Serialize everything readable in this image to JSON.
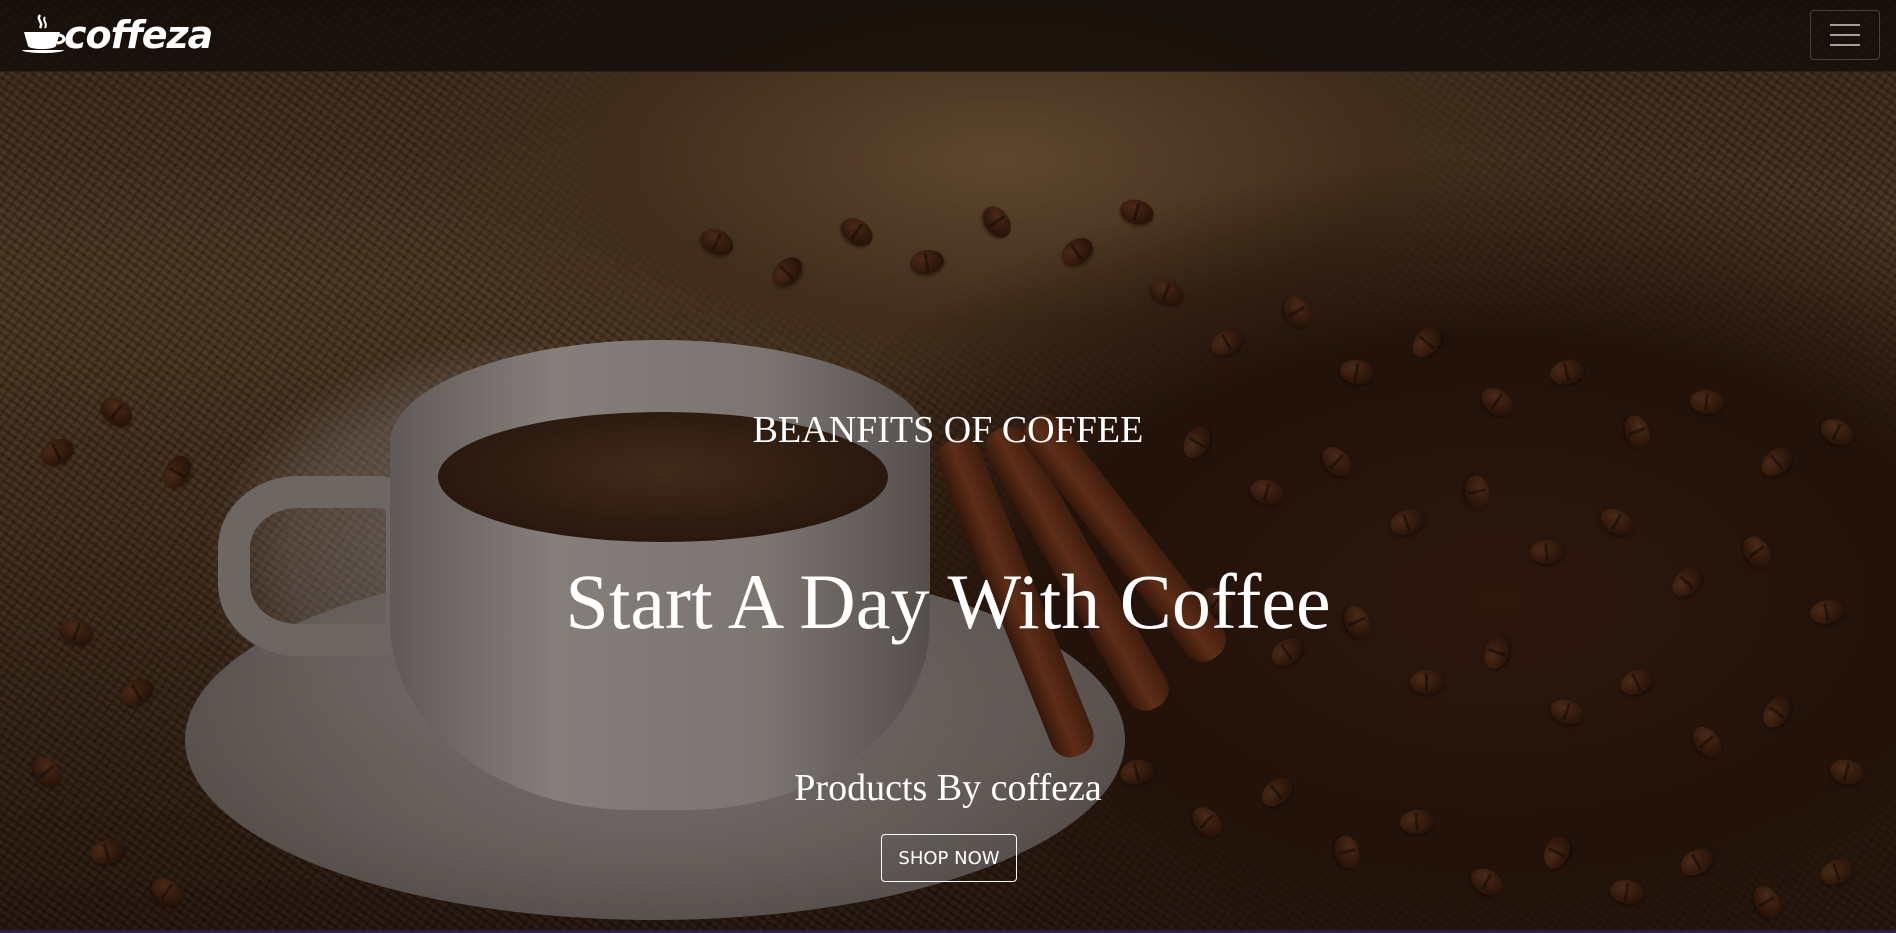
{
  "navbar": {
    "logo_text": "coffeza",
    "logo_icon": "coffee-cup-icon",
    "menu_icon": "hamburger-menu-icon"
  },
  "hero": {
    "subtitle": "BEANFITS OF COFFEE",
    "headline": "Start A Day With Coffee",
    "tagline": "Products By coffeza",
    "cta_label": "SHOP NOW"
  },
  "colors": {
    "text": "#ffffff",
    "navbar_bg": "#120c08",
    "accent_bottom": "#2b1e4a"
  }
}
